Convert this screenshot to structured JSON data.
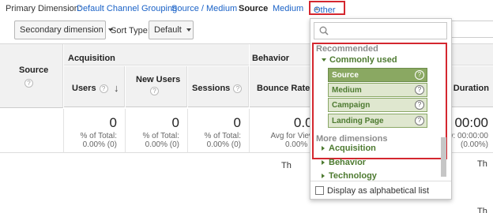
{
  "primary_dimension": {
    "label": "Primary Dimension:",
    "options": [
      "Default Channel Grouping",
      "Source / Medium",
      "Source",
      "Medium"
    ],
    "active": "Source",
    "other": "Other"
  },
  "controls": {
    "secondary_dimension": "Secondary dimension",
    "sort_type_label": "Sort Type:",
    "sort_type_value": "Default"
  },
  "table": {
    "source_header": "Source",
    "groups": {
      "acquisition": "Acquisition",
      "behavior": "Behavior"
    },
    "columns": {
      "users": "Users",
      "new_users": "New Users",
      "sessions": "Sessions",
      "bounce_rate": "Bounce Rate",
      "duration": "n Duration"
    },
    "totals": {
      "users": {
        "value": "0",
        "line1": "% of Total:",
        "line2": "0.00% (0)"
      },
      "new_users": {
        "value": "0",
        "line1": "% of Total:",
        "line2": "0.00% (0)"
      },
      "sessions": {
        "value": "0",
        "line1": "% of Total:",
        "line2": "0.00% (0)"
      },
      "bounce_rate": {
        "value": "0.00",
        "line1": "Avg for View:",
        "line2": "0.00% (0"
      },
      "duration": {
        "value": "00:00",
        "line1": "w: 00:00:00",
        "line2": "(0.00%)"
      }
    },
    "below_text": "Th",
    "right_tail": "Th",
    "right_tail2": "Th"
  },
  "dropdown": {
    "search_placeholder": "",
    "recommended": "Recommended",
    "commonly_used": "Commonly used",
    "items": [
      "Source",
      "Medium",
      "Campaign",
      "Landing Page"
    ],
    "selected_item": "Source",
    "more_dimensions": "More dimensions",
    "categories": [
      "Acquisition",
      "Behavior",
      "Technology"
    ],
    "footer": "Display as alphabetical list"
  },
  "colors": {
    "link": "#1a62c7",
    "highlight": "#d4272f",
    "green": "#4d7a30",
    "selected_bg": "#8aa862"
  }
}
